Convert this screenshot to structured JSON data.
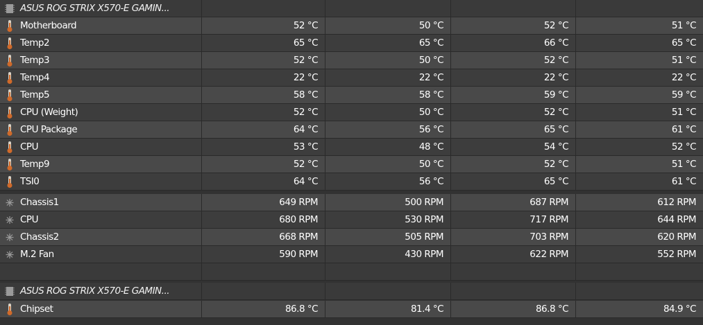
{
  "groups": [
    {
      "title": "ASUS ROG STRIX X570-E GAMIN...",
      "title_icon": "motherboard-chip-icon",
      "rows": [
        {
          "label": "Motherboard",
          "icon": "thermometer-icon",
          "v1": "52 °C",
          "v2": "50 °C",
          "v3": "52 °C",
          "v4": "51 °C"
        },
        {
          "label": "Temp2",
          "icon": "thermometer-icon",
          "v1": "65 °C",
          "v2": "65 °C",
          "v3": "66 °C",
          "v4": "65 °C"
        },
        {
          "label": "Temp3",
          "icon": "thermometer-icon",
          "v1": "52 °C",
          "v2": "50 °C",
          "v3": "52 °C",
          "v4": "51 °C"
        },
        {
          "label": "Temp4",
          "icon": "thermometer-icon",
          "v1": "22 °C",
          "v2": "22 °C",
          "v3": "22 °C",
          "v4": "22 °C"
        },
        {
          "label": "Temp5",
          "icon": "thermometer-icon",
          "v1": "58 °C",
          "v2": "58 °C",
          "v3": "59 °C",
          "v4": "59 °C"
        },
        {
          "label": "CPU (Weight)",
          "icon": "thermometer-icon",
          "v1": "52 °C",
          "v2": "50 °C",
          "v3": "52 °C",
          "v4": "51 °C"
        },
        {
          "label": "CPU Package",
          "icon": "thermometer-icon",
          "v1": "64 °C",
          "v2": "56 °C",
          "v3": "65 °C",
          "v4": "61 °C"
        },
        {
          "label": "CPU",
          "icon": "thermometer-icon",
          "v1": "53 °C",
          "v2": "48 °C",
          "v3": "54 °C",
          "v4": "52 °C"
        },
        {
          "label": "Temp9",
          "icon": "thermometer-icon",
          "v1": "52 °C",
          "v2": "50 °C",
          "v3": "52 °C",
          "v4": "51 °C"
        },
        {
          "label": "TSI0",
          "icon": "thermometer-icon",
          "v1": "64 °C",
          "v2": "56 °C",
          "v3": "65 °C",
          "v4": "61 °C"
        },
        {
          "label": "Chassis1",
          "icon": "fan-icon",
          "v1": "649 RPM",
          "v2": "500 RPM",
          "v3": "687 RPM",
          "v4": "612 RPM"
        },
        {
          "label": "CPU",
          "icon": "fan-icon",
          "v1": "680 RPM",
          "v2": "530 RPM",
          "v3": "717 RPM",
          "v4": "644 RPM"
        },
        {
          "label": "Chassis2",
          "icon": "fan-icon",
          "v1": "668 RPM",
          "v2": "505 RPM",
          "v3": "703 RPM",
          "v4": "620 RPM"
        },
        {
          "label": "M.2 Fan",
          "icon": "fan-icon",
          "v1": "590 RPM",
          "v2": "430 RPM",
          "v3": "622 RPM",
          "v4": "552 RPM"
        }
      ]
    },
    {
      "title": "ASUS ROG STRIX X570-E GAMIN...",
      "title_icon": "motherboard-chip-icon",
      "rows": [
        {
          "label": "Chipset",
          "icon": "thermometer-icon",
          "v1": "86.8 °C",
          "v2": "81.4 °C",
          "v3": "86.8 °C",
          "v4": "84.9 °C"
        }
      ]
    }
  ],
  "colors": {
    "background": "#323232",
    "row_dark": "#3d3d3d",
    "row_light": "#494949",
    "thermometer_body": "#d9d2c6",
    "thermometer_bulb": "#d06a2a",
    "fan": "#9a9a9a"
  }
}
